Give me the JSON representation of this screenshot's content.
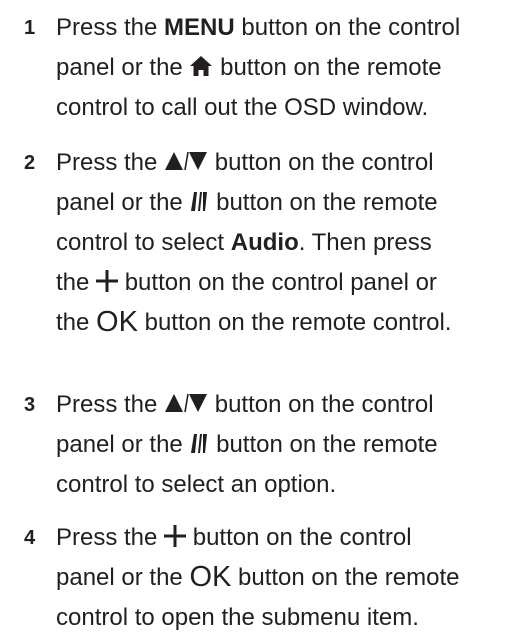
{
  "steps": [
    {
      "number": "1",
      "l1a": "Press the ",
      "l1b": "MENU",
      "l1c": " button on the control",
      "l2a": "panel or the ",
      "l2b": " button on the remote",
      "l3": "control to call out the OSD window."
    },
    {
      "number": "2",
      "l1a": "Press the ",
      "l1b": " button on the control",
      "l2a": "panel or the ",
      "l2b": " button on the remote",
      "l3a": "control to select ",
      "l3b": "Audio",
      "l3c": ". Then press",
      "l4a": "the ",
      "l4b": " button on the control panel or",
      "l5a": "the ",
      "l5ok": "OK",
      "l5b": " button on the remote control."
    },
    {
      "number": "3",
      "l1a": "Press the ",
      "l1b": " button on the control",
      "l2a": "panel or the ",
      "l2b": " button on the remote",
      "l3": "control to select an option."
    },
    {
      "number": "4",
      "l1a": "Press the ",
      "l1b": " button on the control",
      "l2a": "panel or the ",
      "l2ok": "OK",
      "l2b": " button on the remote",
      "l3": "control to open the submenu item."
    }
  ],
  "icons": {
    "home": "home-icon",
    "up_down": "up-down-arrows-icon",
    "remote_updown": "remote-up-down-icon",
    "plus": "plus-icon"
  }
}
